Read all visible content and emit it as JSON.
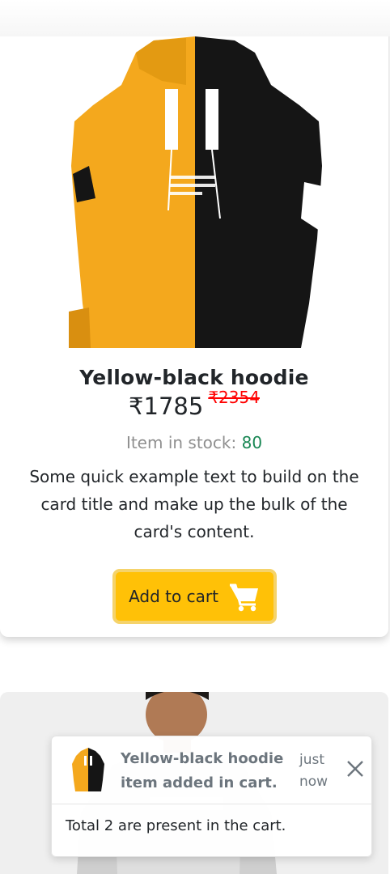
{
  "product": {
    "title": "Yellow-black hoodie",
    "price": "₹1785",
    "original_price": "₹2354",
    "stock_label": "Item in stock: ",
    "stock_count": "80",
    "description": "Some quick example text to build on the card title and make up the bulk of the card's content.",
    "add_to_cart_label": "Add to cart",
    "image_icon": "hoodie-image",
    "cart_icon": "shopping-cart-icon"
  },
  "toast": {
    "title": "Yellow-black hoodie item added in cart.",
    "time": "just now",
    "body": "Total 2 are present in the cart.",
    "close_icon": "close-icon"
  },
  "colors": {
    "button_bg": "#ffc107",
    "old_price": "#ff0000",
    "stock_count": "#198754",
    "hoodie_yellow": "#f4a81d",
    "hoodie_black": "#151515"
  }
}
